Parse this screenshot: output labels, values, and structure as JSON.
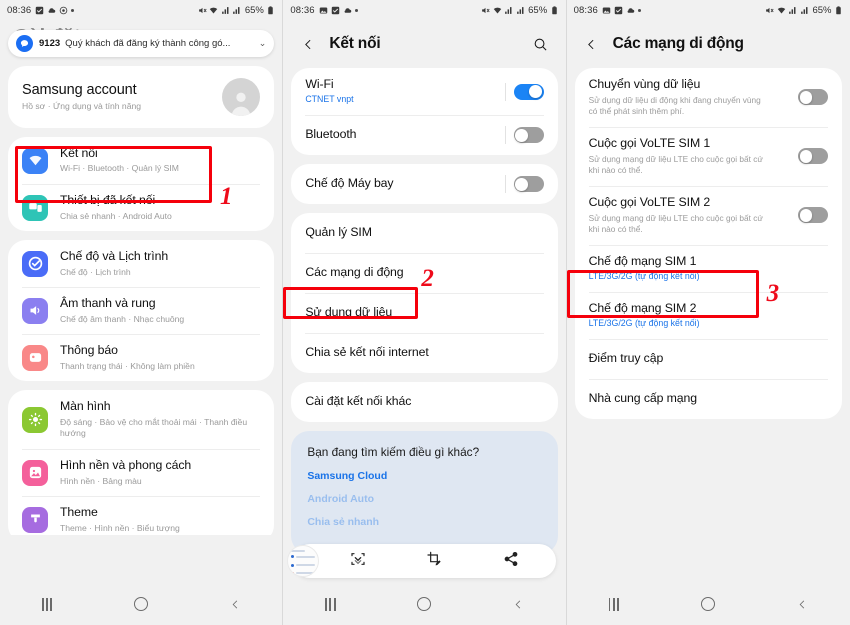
{
  "status_bar": {
    "time": "08:36",
    "battery": "65%",
    "left_icons": [
      "gallery-icon",
      "checkbox-icon",
      "cloud-icon",
      "target-icon",
      "dot-icon"
    ],
    "right_icons": [
      "mute-icon",
      "wifi-icon",
      "signal-sim1-icon",
      "signal-sim2-icon",
      "battery-icon"
    ]
  },
  "panel1": {
    "page_title": "Cài đặt",
    "notification": {
      "sender": "9123",
      "message": "Quý khách đã đăng ký thành công gó...",
      "chevron": "⌄",
      "search_icon": "search-icon"
    },
    "account": {
      "title": "Samsung account",
      "subtitle": "Hồ sơ  ·  Ứng dụng và tính năng",
      "avatar": "person-avatar"
    },
    "group1": [
      {
        "icon": "wifi-icon",
        "color": "#3b82f6",
        "title": "Kết nối",
        "subtitle": "Wi-Fi  ·  Bluetooth  ·  Quản lý SIM"
      },
      {
        "icon": "devices-icon",
        "color": "#2ec4b6",
        "title": "Thiết bị đã kết nối",
        "subtitle": "Chia sẻ nhanh  ·  Android Auto"
      }
    ],
    "group2": [
      {
        "icon": "check-circle-icon",
        "color": "#4a6cf7",
        "title": "Chế độ và Lịch trình",
        "subtitle": "Chế độ  ·  Lịch trình"
      },
      {
        "icon": "sound-icon",
        "color": "#8b7ff0",
        "title": "Âm thanh và rung",
        "subtitle": "Chế độ âm thanh  ·  Nhạc chuông"
      },
      {
        "icon": "notification-icon",
        "color": "#f98888",
        "title": "Thông báo",
        "subtitle": "Thanh trạng thái  ·  Không làm phiền"
      }
    ],
    "group3": [
      {
        "icon": "brightness-icon",
        "color": "#8bc832",
        "title": "Màn hình",
        "subtitle": "Độ sáng  ·  Bảo vệ cho mắt thoải mái  ·  Thanh điều hướng"
      },
      {
        "icon": "wallpaper-icon",
        "color": "#f4609b",
        "title": "Hình nền và phong cách",
        "subtitle": "Hình nền  ·  Bảng màu"
      },
      {
        "icon": "theme-icon",
        "color": "#a66ce0",
        "title": "Theme",
        "subtitle": "Theme  ·  Hình nền  ·  Biểu tượng"
      }
    ],
    "annotation": {
      "number": "1"
    }
  },
  "panel2": {
    "header": {
      "back_icon": "chevron-left-icon",
      "title": "Kết nối",
      "search_icon": "search-icon"
    },
    "group1": [
      {
        "title": "Wi-Fi",
        "subtitle": "CTNET vnpt",
        "toggle": "on"
      },
      {
        "title": "Bluetooth",
        "subtitle": "",
        "toggle": "off"
      }
    ],
    "group2": [
      {
        "title": "Chế độ Máy bay",
        "subtitle": "",
        "toggle": "off"
      }
    ],
    "group3": [
      {
        "title": "Quản lý SIM"
      },
      {
        "title": "Các mạng di động"
      },
      {
        "title": "Sử dụng dữ liệu"
      },
      {
        "title": "Chia sẻ kết nối internet"
      }
    ],
    "group4": [
      {
        "title": "Cài đặt kết nối khác"
      }
    ],
    "promo": {
      "title": "Bạn đang tìm kiếm điều gì khác?",
      "link1": "Samsung Cloud",
      "link2": "Android Auto",
      "link3": "Chia sẻ nhanh"
    },
    "float_toolbar": {
      "icons": [
        "scroll-capture-icon",
        "crop-draw-icon",
        "share-icon"
      ]
    },
    "annotation": {
      "number": "2"
    }
  },
  "panel3": {
    "header": {
      "back_icon": "chevron-left-icon",
      "title": "Các mạng di động"
    },
    "rows": [
      {
        "title": "Chuyển vùng dữ liệu",
        "desc": "Sử dụng dữ liệu di động khi đang chuyển vùng có thể phát sinh thêm phí.",
        "toggle": "off"
      },
      {
        "title": "Cuộc gọi VoLTE SIM 1",
        "desc": "Sử dụng mạng dữ liệu LTE cho cuộc gọi bất cứ khi nào có thể.",
        "toggle": "off"
      },
      {
        "title": "Cuộc gọi VoLTE SIM 2",
        "desc": "Sử dụng mạng dữ liệu LTE cho cuộc gọi bất cứ khi nào có thể.",
        "toggle": "off"
      },
      {
        "title": "Chế độ mạng SIM 1",
        "sub_blue": "LTE/3G/2G (tự động kết nối)"
      },
      {
        "title": "Chế độ mạng SIM 2",
        "sub_blue": "LTE/3G/2G (tự động kết nối)"
      },
      {
        "title": "Điểm truy cập"
      },
      {
        "title": "Nhà cung cấp mạng"
      }
    ],
    "annotation": {
      "number": "3"
    }
  },
  "nav": {
    "recent_label": "recent-apps-button",
    "home_label": "home-button",
    "back_label": "back-button"
  },
  "colors": {
    "accent_blue": "#1a73e8",
    "toggle_on": "#1b84f5",
    "annotation_red": "#f5000b",
    "screen_bg": "#f1f1f1"
  }
}
